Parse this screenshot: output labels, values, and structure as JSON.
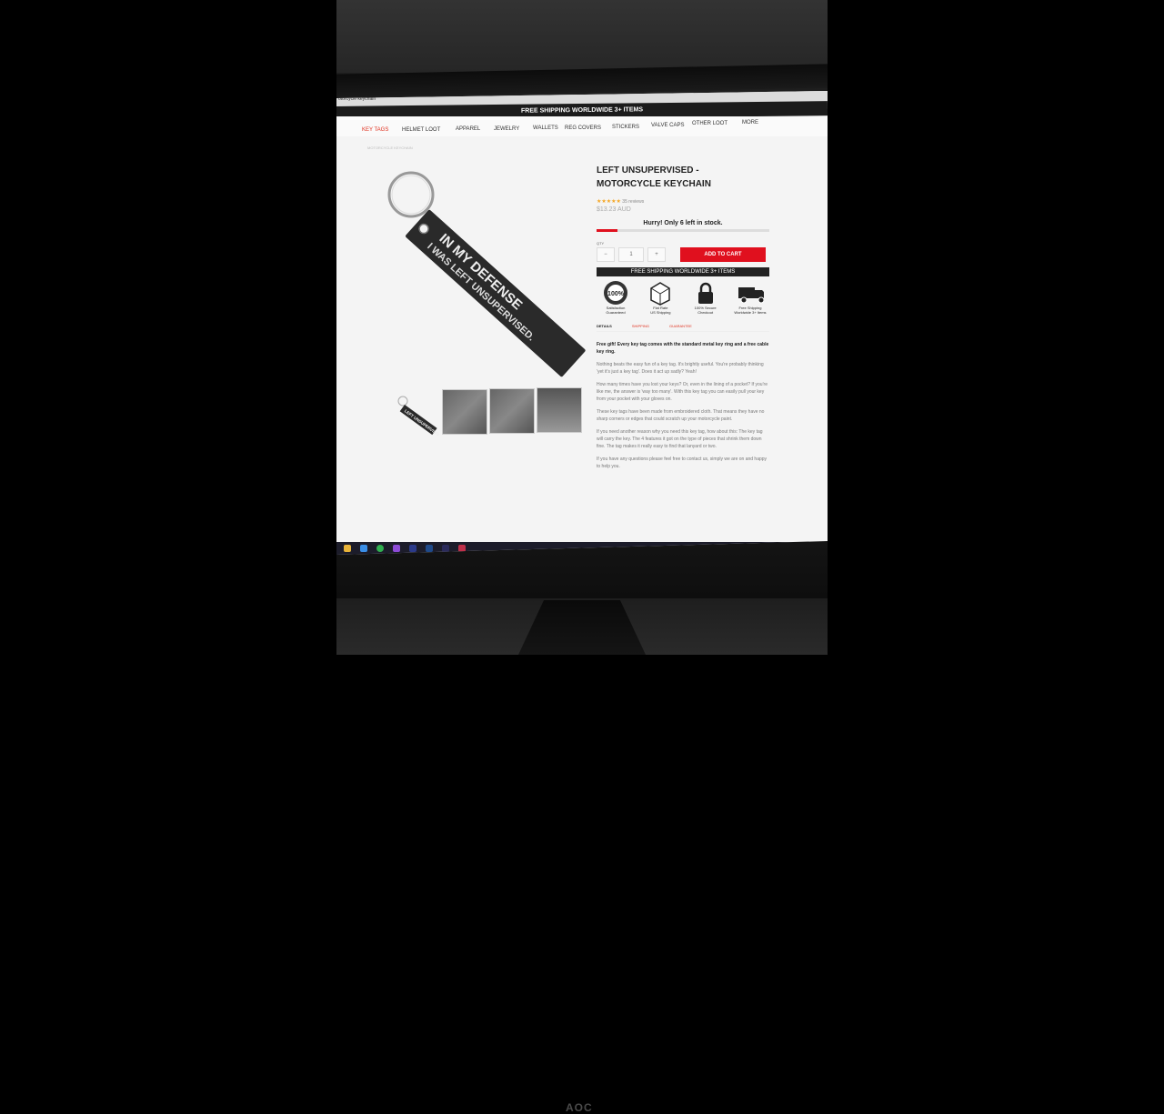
{
  "browser": {
    "tab_label": "otorcycle keychain"
  },
  "promo": {
    "text": "FREE SHIPPING WORLDWIDE 3+ ITEMS"
  },
  "nav": {
    "items": [
      {
        "label": "KEY TAGS",
        "active": true
      },
      {
        "label": "HELMET LOOT",
        "active": false
      },
      {
        "label": "APPAREL",
        "active": false
      },
      {
        "label": "JEWELRY",
        "active": false
      },
      {
        "label": "WALLETS",
        "active": false
      },
      {
        "label": "REG COVERS",
        "active": false
      },
      {
        "label": "STICKERS",
        "active": false
      },
      {
        "label": "VALVE CAPS",
        "active": false
      },
      {
        "label": "OTHER LOOT",
        "active": false
      },
      {
        "label": "MORE",
        "active": false
      }
    ]
  },
  "product": {
    "title_line1": "LEFT UNSUPERVISED -",
    "title_line2": "MOTORCYCLE KEYCHAIN",
    "reviews": "35 reviews",
    "price": "$13.23 AUD",
    "hurry": "Hurry! Only 6 left in stock.",
    "stock_fraction": 0.12,
    "qty_label": "QTY",
    "qty_value": "1",
    "qty_minus": "−",
    "qty_plus": "+",
    "add_to_cart": "ADD TO CART",
    "ship_banner": "FREE SHIPPING WORLDWIDE 3+ ITEMS",
    "tag_line1": "IN MY DEFENSE",
    "tag_line2": "I WAS LEFT UNSUPERVISED.",
    "thumb_text": "LEFT UNSUPERVISED"
  },
  "badges": [
    {
      "icon": "satisfaction-seal-icon",
      "line1": "Satisfaction",
      "line2": "Guaranteed"
    },
    {
      "icon": "shipping-box-icon",
      "line1": "Flat Rate",
      "line2": "US Shipping"
    },
    {
      "icon": "padlock-icon",
      "line1": "100% Secure",
      "line2": "Checkout"
    },
    {
      "icon": "delivery-truck-icon",
      "line1": "Free Shipping",
      "line2": "Worldwide 3+ Items"
    }
  ],
  "tabs": [
    {
      "label": "DETAILS",
      "active": true
    },
    {
      "label": "SHIPPING",
      "active": false
    },
    {
      "label": "GUARANTEE",
      "active": false
    }
  ],
  "description": {
    "lead": "Free gift! Every key tag comes with the standard metal key ring and a free cable key ring.",
    "p1": "Nothing beats the easy fun of a key tag. It's brightly useful. You're probably thinking 'yet it's just a key tag'. Does it act up sadly? Yeah!",
    "p2": "How many times have you lost your keys? Or, even in the lining of a pocket? If you're like me, the answer is 'way too many'. With this key tag you can easily pull your key from your pocket with your gloves on.",
    "p3": "These key tags have been made from embroidered cloth. That means they have no sharp corners or edges that could scratch up your motorcycle paint.",
    "p4": "If you need another reason why you need this key tag, how about this: The key tag will carry the key. The 4 features it got on the type of pieces that shrink them down fine. The tag makes it really easy to find that lanyard or two.",
    "p5": "If you have any questions please feel free to contact us, simply we are on and happy to help you."
  }
}
